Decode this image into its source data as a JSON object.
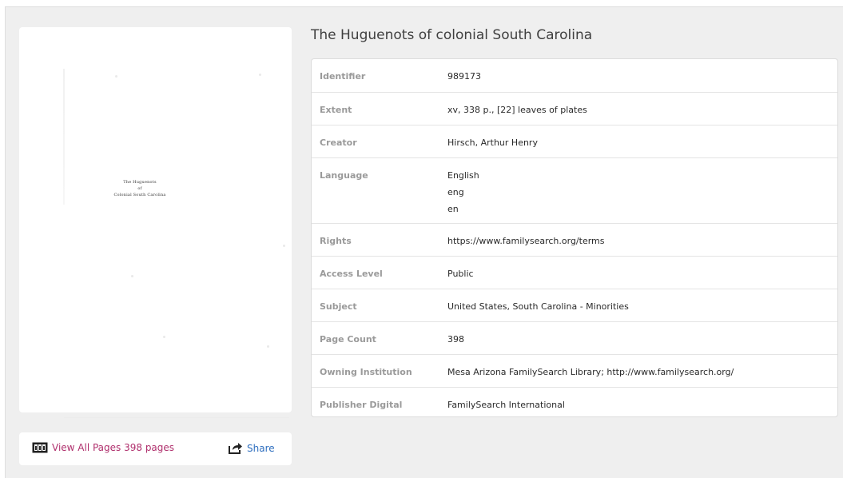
{
  "record": {
    "title": "The Huguenots of colonial South Carolina",
    "fields": [
      {
        "label": "Identifier",
        "values": [
          "989173"
        ]
      },
      {
        "label": "Extent",
        "values": [
          "xv, 338 p., [22] leaves of plates"
        ]
      },
      {
        "label": "Creator",
        "values": [
          "Hirsch, Arthur Henry"
        ]
      },
      {
        "label": "Language",
        "values": [
          "English",
          "eng",
          "en"
        ]
      },
      {
        "label": "Rights",
        "values": [
          "https://www.familysearch.org/terms"
        ]
      },
      {
        "label": "Access Level",
        "values": [
          "Public"
        ]
      },
      {
        "label": "Subject",
        "values": [
          "United States, South Carolina - Minorities"
        ]
      },
      {
        "label": "Page Count",
        "values": [
          "398"
        ]
      },
      {
        "label": "Owning Institution",
        "values": [
          "Mesa Arizona FamilySearch Library; http://www.familysearch.org/"
        ]
      },
      {
        "label": "Publisher Digital",
        "values": [
          "FamilySearch International"
        ]
      }
    ]
  },
  "thumbnail": {
    "line1": "The Huguenots",
    "line2": "of",
    "line3": "Colonial South Carolina"
  },
  "actions": {
    "view_all_label": "View All Pages 398 pages",
    "view_all_icon": "pages-icon",
    "share_label": "Share",
    "share_icon": "share-icon"
  },
  "colors": {
    "view_all_link": "#b0306d",
    "share_link": "#2f6fbf",
    "field_label": "#9a9a9a",
    "background": "#efefef"
  }
}
